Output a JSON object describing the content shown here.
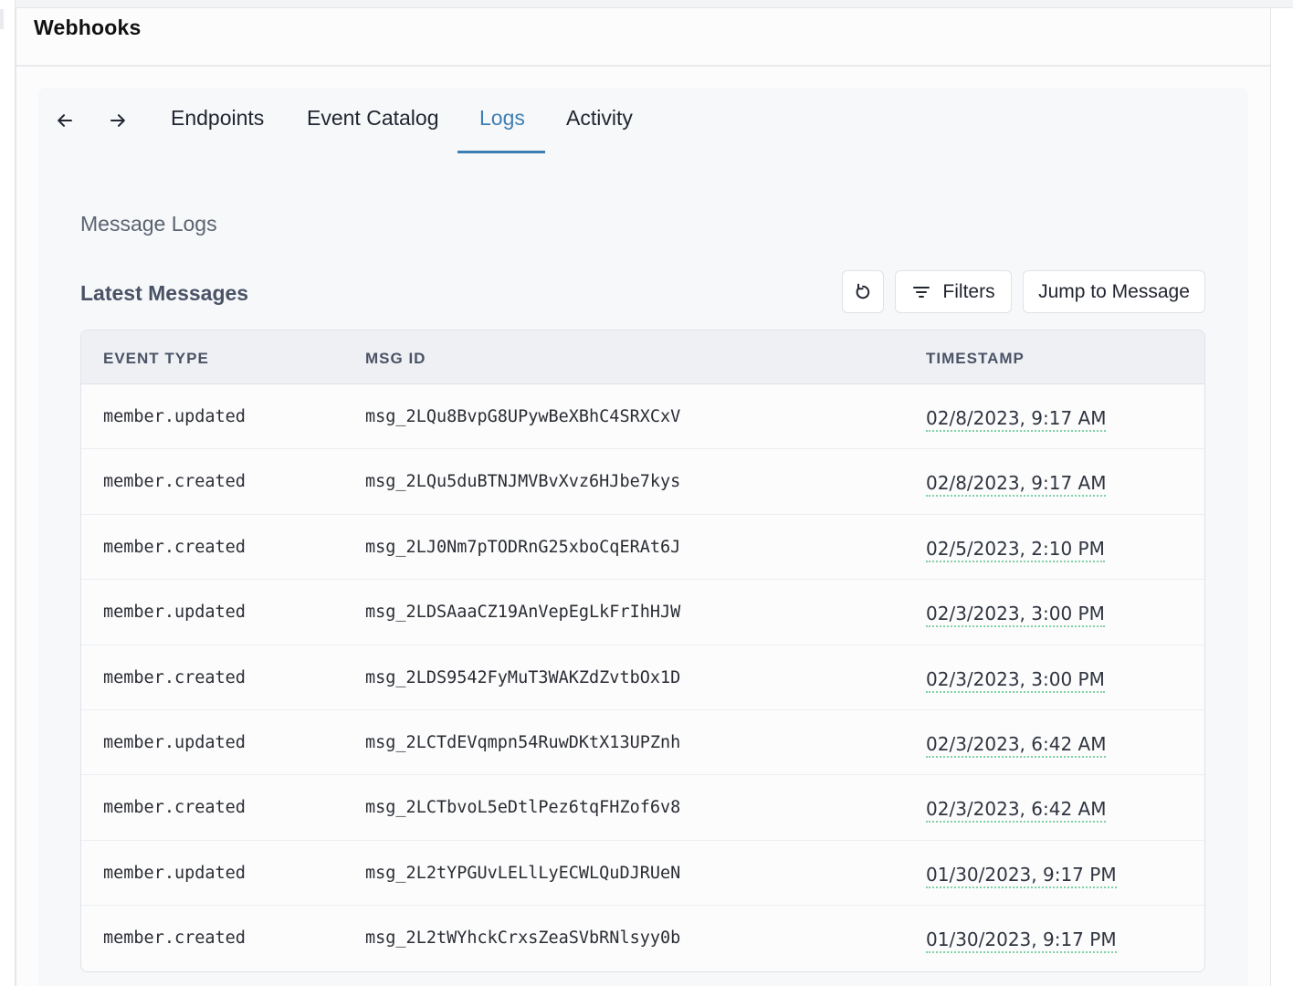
{
  "app": {
    "title": "Webhooks"
  },
  "nav": {
    "back_icon": "arrow-left-icon",
    "forward_icon": "arrow-right-icon",
    "tabs": [
      {
        "label": "Endpoints",
        "active": false
      },
      {
        "label": "Event Catalog",
        "active": false
      },
      {
        "label": "Logs",
        "active": true
      },
      {
        "label": "Activity",
        "active": false
      }
    ]
  },
  "page": {
    "heading": "Message Logs",
    "section_title": "Latest Messages"
  },
  "toolbar": {
    "refresh_icon": "refresh-icon",
    "filters_icon": "filter-icon",
    "filters_label": "Filters",
    "jump_label": "Jump to Message"
  },
  "table": {
    "columns": [
      "EVENT TYPE",
      "MSG ID",
      "TIMESTAMP"
    ],
    "rows": [
      {
        "event_type": "member.updated",
        "msg_id": "msg_2LQu8BvpG8UPywBeXBhC4SRXCxV",
        "timestamp": "02/8/2023, 9:17 AM"
      },
      {
        "event_type": "member.created",
        "msg_id": "msg_2LQu5duBTNJMVBvXvz6HJbe7kys",
        "timestamp": "02/8/2023, 9:17 AM"
      },
      {
        "event_type": "member.created",
        "msg_id": "msg_2LJ0Nm7pTODRnG25xboCqERAt6J",
        "timestamp": "02/5/2023, 2:10 PM"
      },
      {
        "event_type": "member.updated",
        "msg_id": "msg_2LDSAaaCZ19AnVepEgLkFrIhHJW",
        "timestamp": "02/3/2023, 3:00 PM"
      },
      {
        "event_type": "member.created",
        "msg_id": "msg_2LDS9542FyMuT3WAKZdZvtbOx1D",
        "timestamp": "02/3/2023, 3:00 PM"
      },
      {
        "event_type": "member.updated",
        "msg_id": "msg_2LCTdEVqmpn54RuwDKtX13UPZnh",
        "timestamp": "02/3/2023, 6:42 AM"
      },
      {
        "event_type": "member.created",
        "msg_id": "msg_2LCTbvoL5eDtlPez6tqFHZof6v8",
        "timestamp": "02/3/2023, 6:42 AM"
      },
      {
        "event_type": "member.updated",
        "msg_id": "msg_2L2tYPGUvLELlLyECWLQuDJRUeN",
        "timestamp": "01/30/2023, 9:17 PM"
      },
      {
        "event_type": "member.created",
        "msg_id": "msg_2L2tWYhckCrxsZeaSVbRNlsyy0b",
        "timestamp": "01/30/2023, 9:17 PM"
      }
    ]
  },
  "colors": {
    "accent": "#3f7eb3",
    "timestamp_underline": "#7fd1a6"
  }
}
